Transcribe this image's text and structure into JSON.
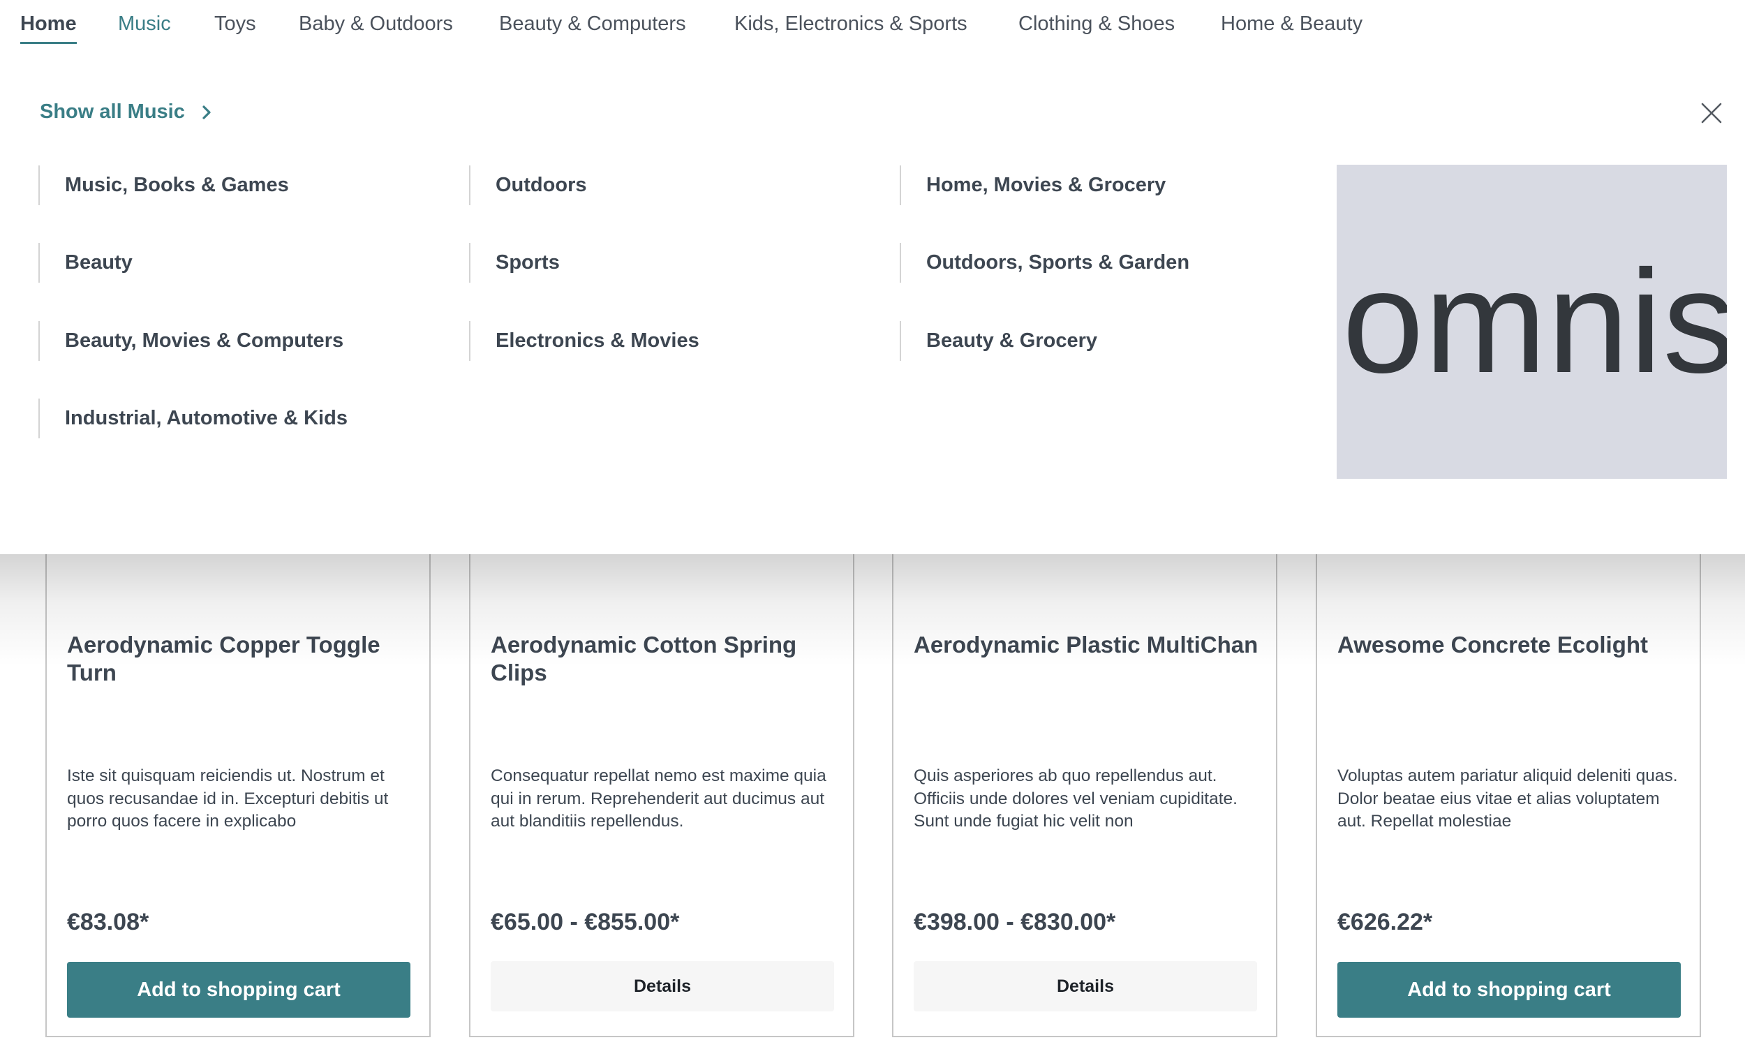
{
  "nav": {
    "items": [
      {
        "label": "Home"
      },
      {
        "label": "Music"
      },
      {
        "label": "Toys"
      },
      {
        "label": "Baby & Outdoors"
      },
      {
        "label": "Beauty & Computers"
      },
      {
        "label": "Kids, Electronics & Sports"
      },
      {
        "label": "Clothing & Shoes"
      },
      {
        "label": "Home & Beauty"
      }
    ],
    "active": "Home",
    "hovered": "Music"
  },
  "flyout": {
    "show_all_label": "Show all Music",
    "columns": [
      [
        "Music, Books & Games",
        "Beauty",
        "Beauty, Movies & Computers",
        "Industrial, Automotive & Kids"
      ],
      [
        "Outdoors",
        "Sports",
        "Electronics & Movies"
      ],
      [
        "Home, Movies & Grocery",
        "Outdoors, Sports & Garden",
        "Beauty & Grocery"
      ]
    ],
    "teaser_text": "omnis"
  },
  "products": [
    {
      "name": "Aerodynamic Copper Toggle Turn",
      "description": "Iste sit quisquam reiciendis ut. Nostrum et quos recusandae id in. Excepturi debitis ut porro quos facere in explicabo",
      "price": "€83.08*",
      "action": "Add to shopping cart"
    },
    {
      "name": "Aerodynamic Cotton Spring Clips",
      "description": "Consequatur repellat nemo est maxime quia qui in rerum. Reprehenderit aut ducimus aut aut blanditiis repellendus.",
      "price": "€65.00 - €855.00*",
      "action": "Details"
    },
    {
      "name": "Aerodynamic Plastic MultiChan",
      "description": "Quis asperiores ab quo repellendus aut. Officiis unde dolores vel veniam cupiditate. Sunt unde fugiat hic velit non",
      "price": "€398.00 - €830.00*",
      "action": "Details"
    },
    {
      "name": "Awesome Concrete Ecolight",
      "description": "Voluptas autem pariatur aliquid deleniti quas. Dolor beatae eius vitae et alias voluptatem aut. Repellat molestiae",
      "price": "€626.22*",
      "action": "Add to shopping cart"
    }
  ],
  "colors": {
    "accent": "#3a7e86",
    "text": "#3d4651",
    "teaser_bg": "#d8dae3"
  }
}
